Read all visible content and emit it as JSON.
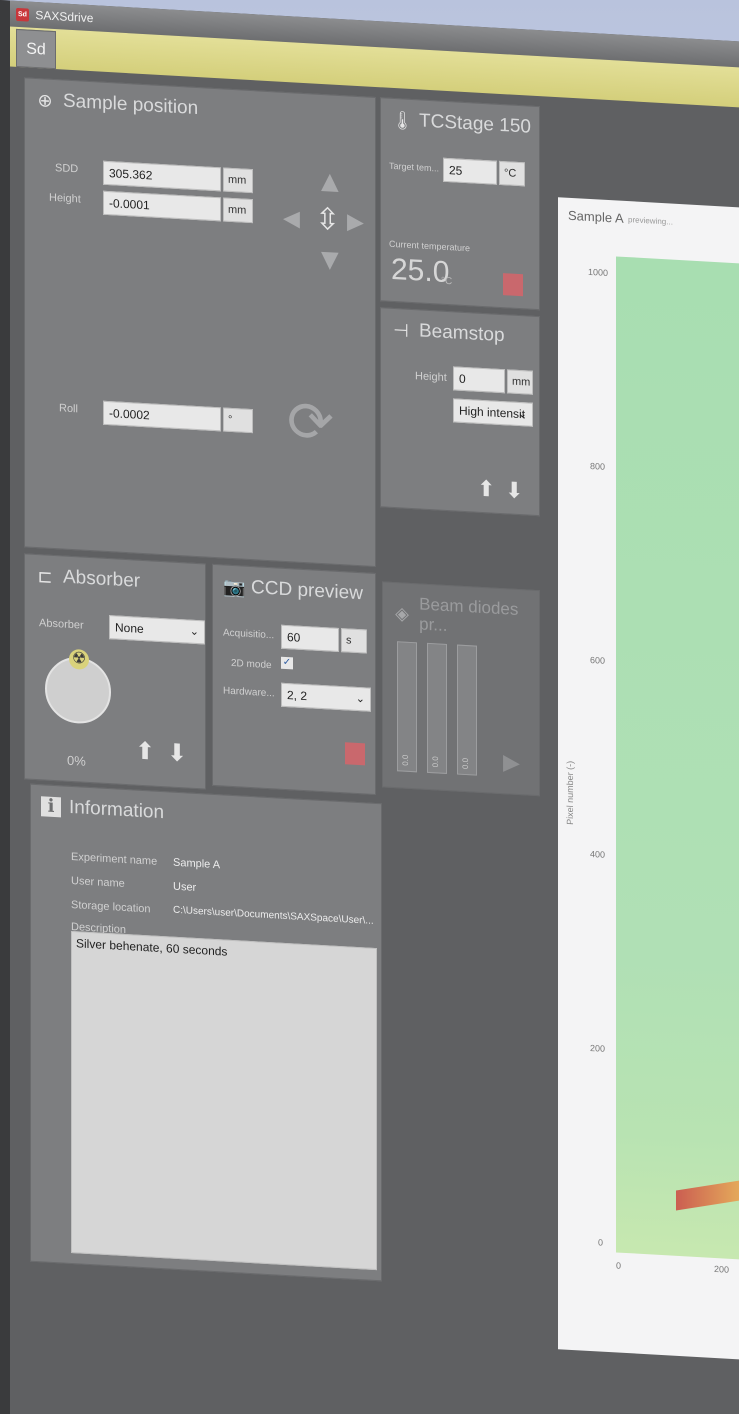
{
  "window": {
    "title": "SAXSdrive",
    "icon_text": "Sd"
  },
  "ribbon": {
    "app_button": "Sd"
  },
  "sample_position": {
    "title": "Sample position",
    "sdd": {
      "label": "SDD",
      "value": "305.362",
      "unit": "mm"
    },
    "height": {
      "label": "Height",
      "value": "-0.0001",
      "unit": "mm"
    },
    "roll": {
      "label": "Roll",
      "value": "-0.0002",
      "unit": "°"
    }
  },
  "tcstage": {
    "title": "TCStage 150",
    "target_label": "Target tem...",
    "target_value": "25",
    "target_unit": "°C",
    "current_label": "Current temperature",
    "current_value": "25.0",
    "current_unit": "°C"
  },
  "beamstop": {
    "title": "Beamstop",
    "height_label": "Height",
    "height_value": "0",
    "height_unit": "mm",
    "mode": "High intensit"
  },
  "absorber": {
    "title": "Absorber",
    "label": "Absorber",
    "value": "None",
    "percent": "0%"
  },
  "ccd_preview": {
    "title": "CCD preview",
    "acq_label": "Acquisitio...",
    "acq_value": "60",
    "acq_unit": "s",
    "mode_label": "2D mode",
    "hw_label": "Hardware...",
    "hw_value": "2, 2"
  },
  "beam_diodes": {
    "title": "Beam diodes pr...",
    "values": [
      "0.0",
      "0.0",
      "0.0"
    ]
  },
  "information": {
    "title": "Information",
    "experiment_label": "Experiment name",
    "experiment_value": "Sample A",
    "user_label": "User name",
    "user_value": "User",
    "storage_label": "Storage location",
    "storage_value": "C:\\Users\\user\\Documents\\SAXSpace\\User\\...",
    "description_label": "Description",
    "description_value": "Silver behenate, 60 seconds"
  },
  "plot": {
    "title": "Sample A",
    "status": "previewing...",
    "ylabel": "Pixel number (-)",
    "y_ticks": [
      "1000",
      "800",
      "600",
      "400",
      "200",
      "0"
    ],
    "x_ticks": [
      "0",
      "200"
    ]
  }
}
